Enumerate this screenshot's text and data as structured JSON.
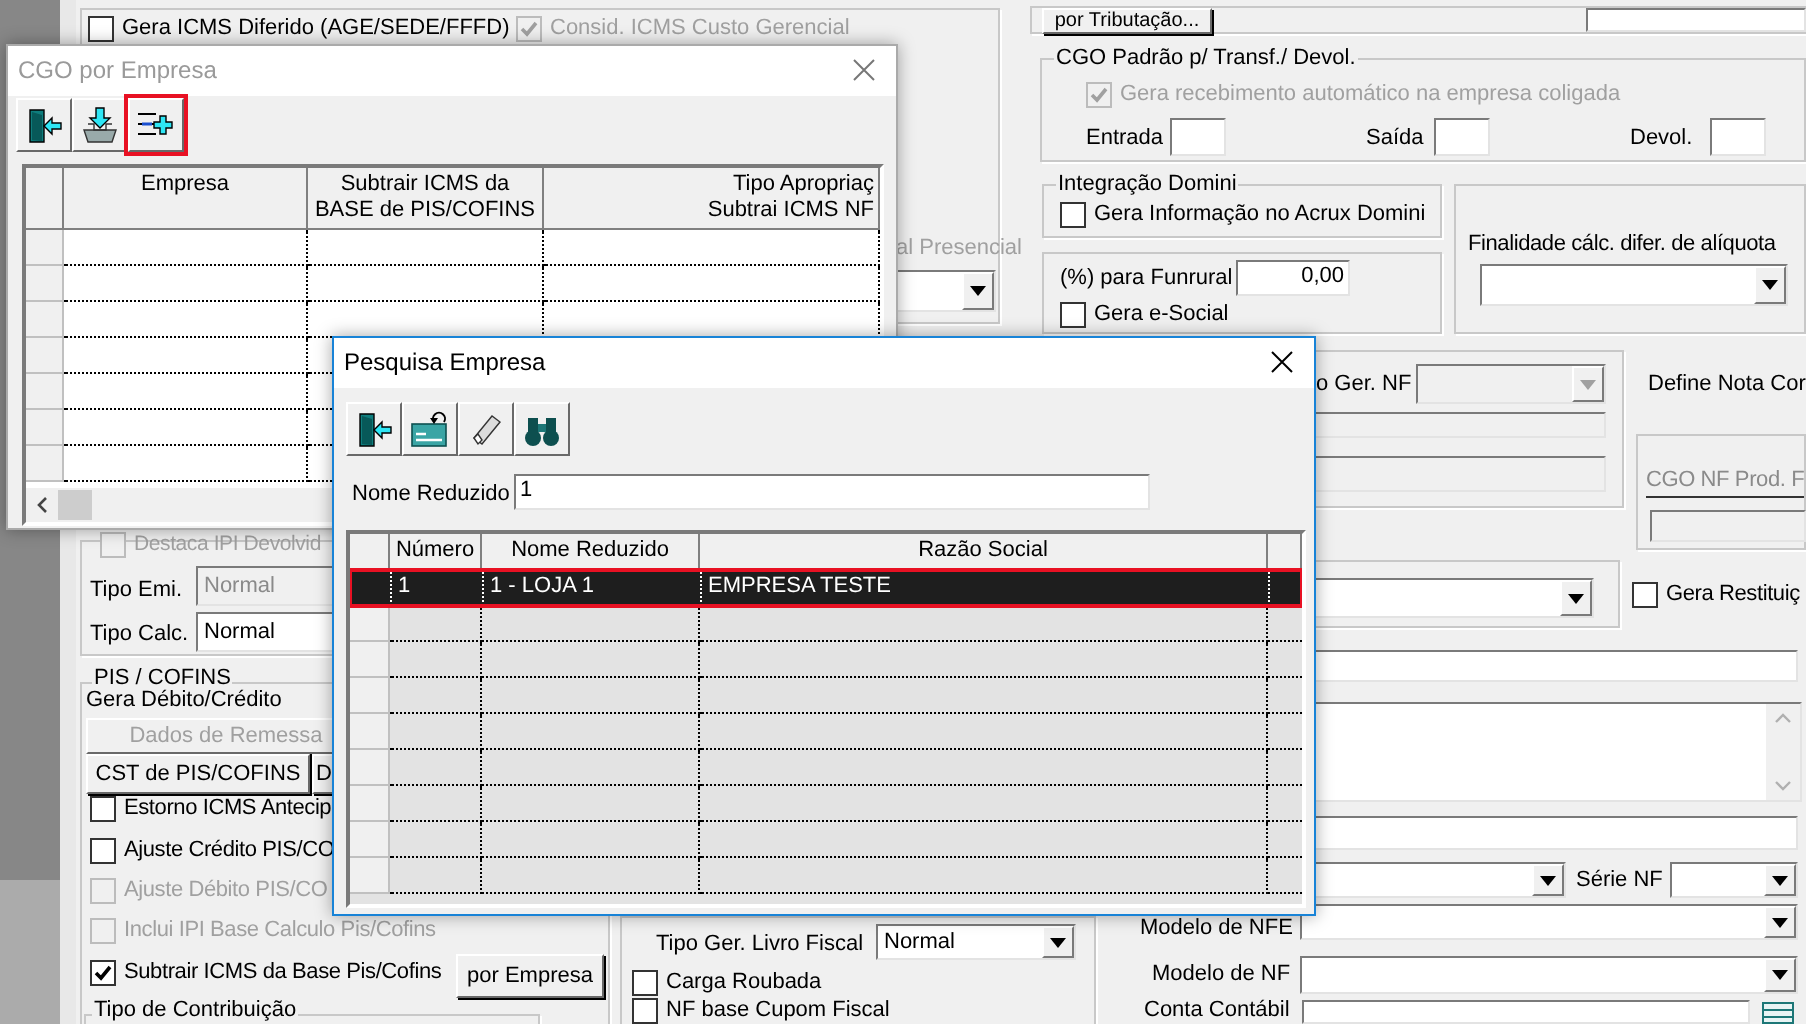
{
  "main_form": {
    "top_checks": [
      {
        "label": "Gera ICMS Diferido (AGE/SEDE/FFFD)",
        "checked": false,
        "disabled": false
      },
      {
        "label": "Consid. ICMS Custo Gerencial",
        "checked": true,
        "disabled": true
      }
    ],
    "tributacao_button": "por Tributação...",
    "cgo_padrao": {
      "title": "CGO Padrão p/ Transf./ Devol.",
      "auto_receive": {
        "label": "Gera recebimento automático na empresa coligada",
        "checked": true,
        "disabled": true
      },
      "fields": [
        "Entrada",
        "Saída",
        "Devol."
      ]
    },
    "integracao": {
      "title": "Integração Domini",
      "check": {
        "label": "Gera Informação no Acrux Domini",
        "checked": false,
        "disabled": false
      }
    },
    "funrural": {
      "label": "(%) para Funrural",
      "value": "0,00",
      "esocial": {
        "label": "Gera e-Social",
        "checked": false,
        "disabled": false
      }
    },
    "finalidade_label": "Finalidade cálc. difer. de alíquota",
    "presencial_label": "al Presencial",
    "ger_nf_label": "o Ger. NF",
    "define_nota_label": "Define Nota Cor",
    "cgo_nf_prod_label": "CGO NF Prod. F",
    "restituicao": {
      "label": "Gera Restituiç",
      "checked": false,
      "disabled": false
    },
    "serie_nf_label": "Série NF",
    "modelo_nfe_label": "Modelo de NFE",
    "modelo_nf_label": "Modelo de NF",
    "conta_contabil_label": "Conta Contábil",
    "destaca_ipi": {
      "label": "Destaca IPI Devolvid",
      "checked": false,
      "disabled": true
    },
    "tipo_emi": {
      "label": "Tipo Emi.",
      "value": "Normal",
      "disabled": true
    },
    "tipo_calc": {
      "label": "Tipo Calc.",
      "value": "Normal",
      "disabled": false
    },
    "pis_cofins": {
      "title": "PIS / COFINS",
      "subtitle": "Gera Débito/Crédito",
      "buttons": [
        {
          "label": "Dados de Remessa",
          "disabled": true
        },
        {
          "label": "CST de PIS/COFINS",
          "disabled": false
        },
        {
          "label": "D",
          "disabled": false
        }
      ],
      "checks": [
        {
          "label": "Estorno ICMS Antecip",
          "checked": false,
          "disabled": false
        },
        {
          "label": "Ajuste Crédito PIS/CO",
          "checked": false,
          "disabled": false
        },
        {
          "label": "Ajuste Débito PIS/CO",
          "checked": false,
          "disabled": true
        },
        {
          "label": "Inclui IPI Base Calculo Pis/Cofins",
          "checked": false,
          "disabled": true
        },
        {
          "label": "Subtrair ICMS da Base Pis/Cofins",
          "checked": true,
          "disabled": false
        }
      ],
      "por_empresa_button": "por Empresa"
    },
    "tipo_contribuicao_title": "Tipo de Contribuição",
    "livro_fiscal": {
      "label": "Tipo Ger. Livro Fiscal",
      "value": "Normal"
    },
    "bottom_checks": [
      {
        "label": "Carga Roubada",
        "checked": false,
        "disabled": false
      },
      {
        "label": "NF base Cupom Fiscal",
        "checked": false,
        "disabled": false
      }
    ]
  },
  "cgo_window": {
    "title": "CGO por Empresa",
    "active": false,
    "toolbar": [
      {
        "kind": "exit",
        "highlighted": false
      },
      {
        "kind": "import",
        "highlighted": false
      },
      {
        "kind": "add",
        "highlighted": true
      }
    ],
    "columns": [
      "Empresa",
      "Subtrair ICMS da\nBASE de PIS/COFINS",
      "Tipo Apropriaç\nSubtrai ICMS NF"
    ]
  },
  "search_window": {
    "title": "Pesquisa Empresa",
    "active": true,
    "toolbar": [
      {
        "kind": "exit",
        "highlighted": false
      },
      {
        "kind": "card_undo",
        "highlighted": false
      },
      {
        "kind": "eraser",
        "highlighted": false
      },
      {
        "kind": "binoculars",
        "highlighted": false
      }
    ],
    "filter": {
      "label": "Nome Reduzido",
      "value": "1"
    },
    "columns": [
      "Número",
      "Nome Reduzido",
      "Razão Social"
    ],
    "rows": [
      {
        "numero": "1",
        "nome_reduzido": "1 - LOJA 1",
        "razao_social": "EMPRESA TESTE",
        "selected": true
      }
    ]
  }
}
